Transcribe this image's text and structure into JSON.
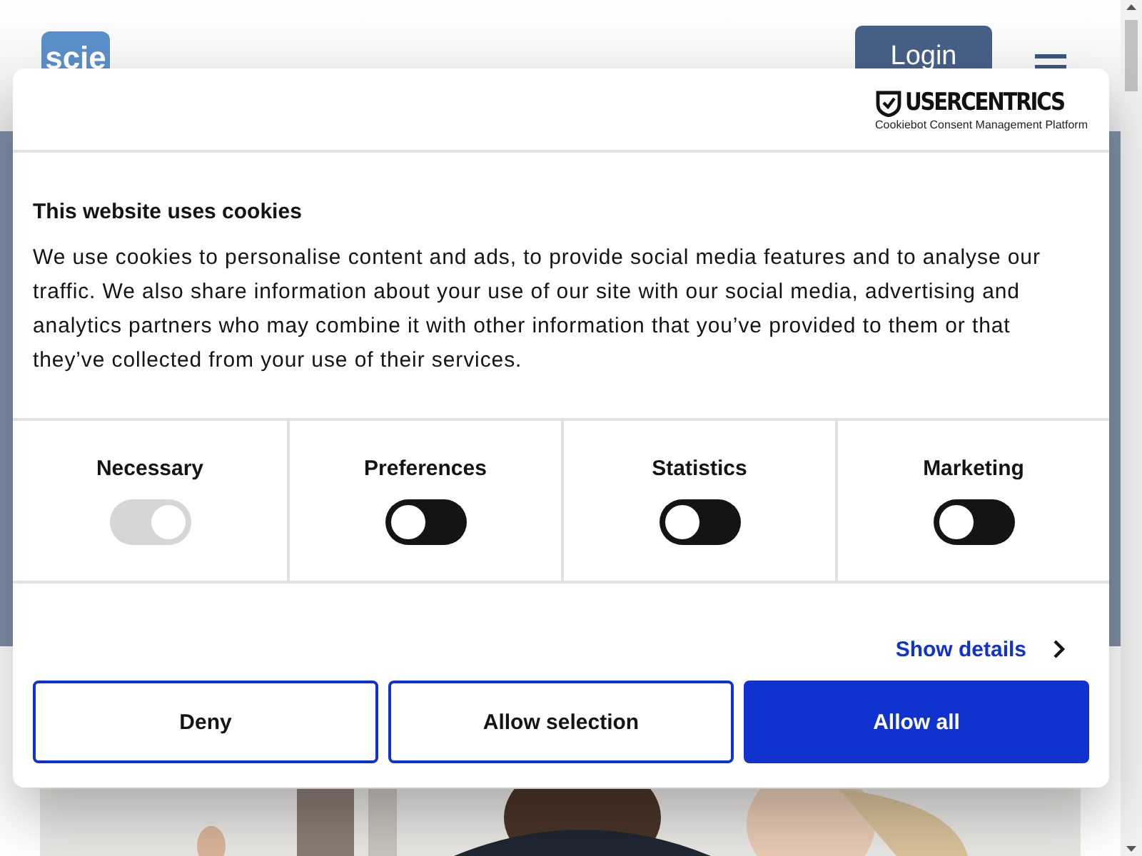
{
  "site": {
    "logo": "scie",
    "login": "Login"
  },
  "dialog": {
    "brand": "USERCENTRICS",
    "brand_sub": "Cookiebot Consent Management Platform",
    "title": "This website uses cookies",
    "body": "We use cookies to personalise content and ads, to provide social media features and to analyse our traffic. We also share information about your use of our site with our social media, advertising and analytics partners who may combine it with other information that you’ve provided to them or that they’ve collected from your use of their services.",
    "categories": [
      {
        "label": "Necessary",
        "checked": true,
        "disabled": true
      },
      {
        "label": "Preferences",
        "checked": false,
        "disabled": false
      },
      {
        "label": "Statistics",
        "checked": false,
        "disabled": false
      },
      {
        "label": "Marketing",
        "checked": false,
        "disabled": false
      }
    ],
    "details_link": "Show details",
    "buttons": [
      {
        "label": "Deny",
        "kind": "outline"
      },
      {
        "label": "Allow selection",
        "kind": "outline"
      },
      {
        "label": "Allow all",
        "kind": "primary"
      }
    ]
  }
}
